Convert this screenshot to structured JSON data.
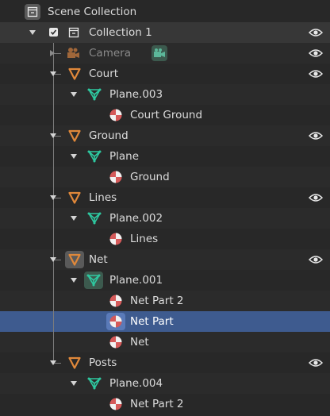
{
  "outliner": {
    "scene_collection": {
      "label": "Scene Collection",
      "icon": "collection-icon"
    },
    "collection": {
      "label": "Collection 1",
      "checked": true,
      "icon": "collection-icon",
      "visibility_icon": "eye-icon"
    },
    "items": [
      {
        "label": "Camera",
        "type": "camera",
        "disabled": true,
        "extra_icon": "camera-data-icon"
      },
      {
        "label": "Court",
        "type": "object",
        "mesh": {
          "label": "Plane.003",
          "materials": [
            "Court Ground"
          ]
        }
      },
      {
        "label": "Ground",
        "type": "object",
        "mesh": {
          "label": "Plane",
          "materials": [
            "Ground"
          ]
        }
      },
      {
        "label": "Lines",
        "type": "object",
        "mesh": {
          "label": "Plane.002",
          "materials": [
            "Lines"
          ]
        }
      },
      {
        "label": "Net",
        "type": "object",
        "active": true,
        "mesh": {
          "label": "Plane.001",
          "materials": [
            "Net Part 2",
            "Net Part",
            "Net"
          ],
          "selected_material": "Net Part"
        }
      },
      {
        "label": "Posts",
        "type": "object",
        "mesh": {
          "label": "Plane.004",
          "materials": [
            "Net Part 2"
          ]
        }
      }
    ]
  },
  "colors": {
    "object_orange": "#e0883a",
    "mesh_green": "#2ec8a0",
    "material_red": "#d55a5a",
    "selection_blue": "#3e5b8f"
  }
}
